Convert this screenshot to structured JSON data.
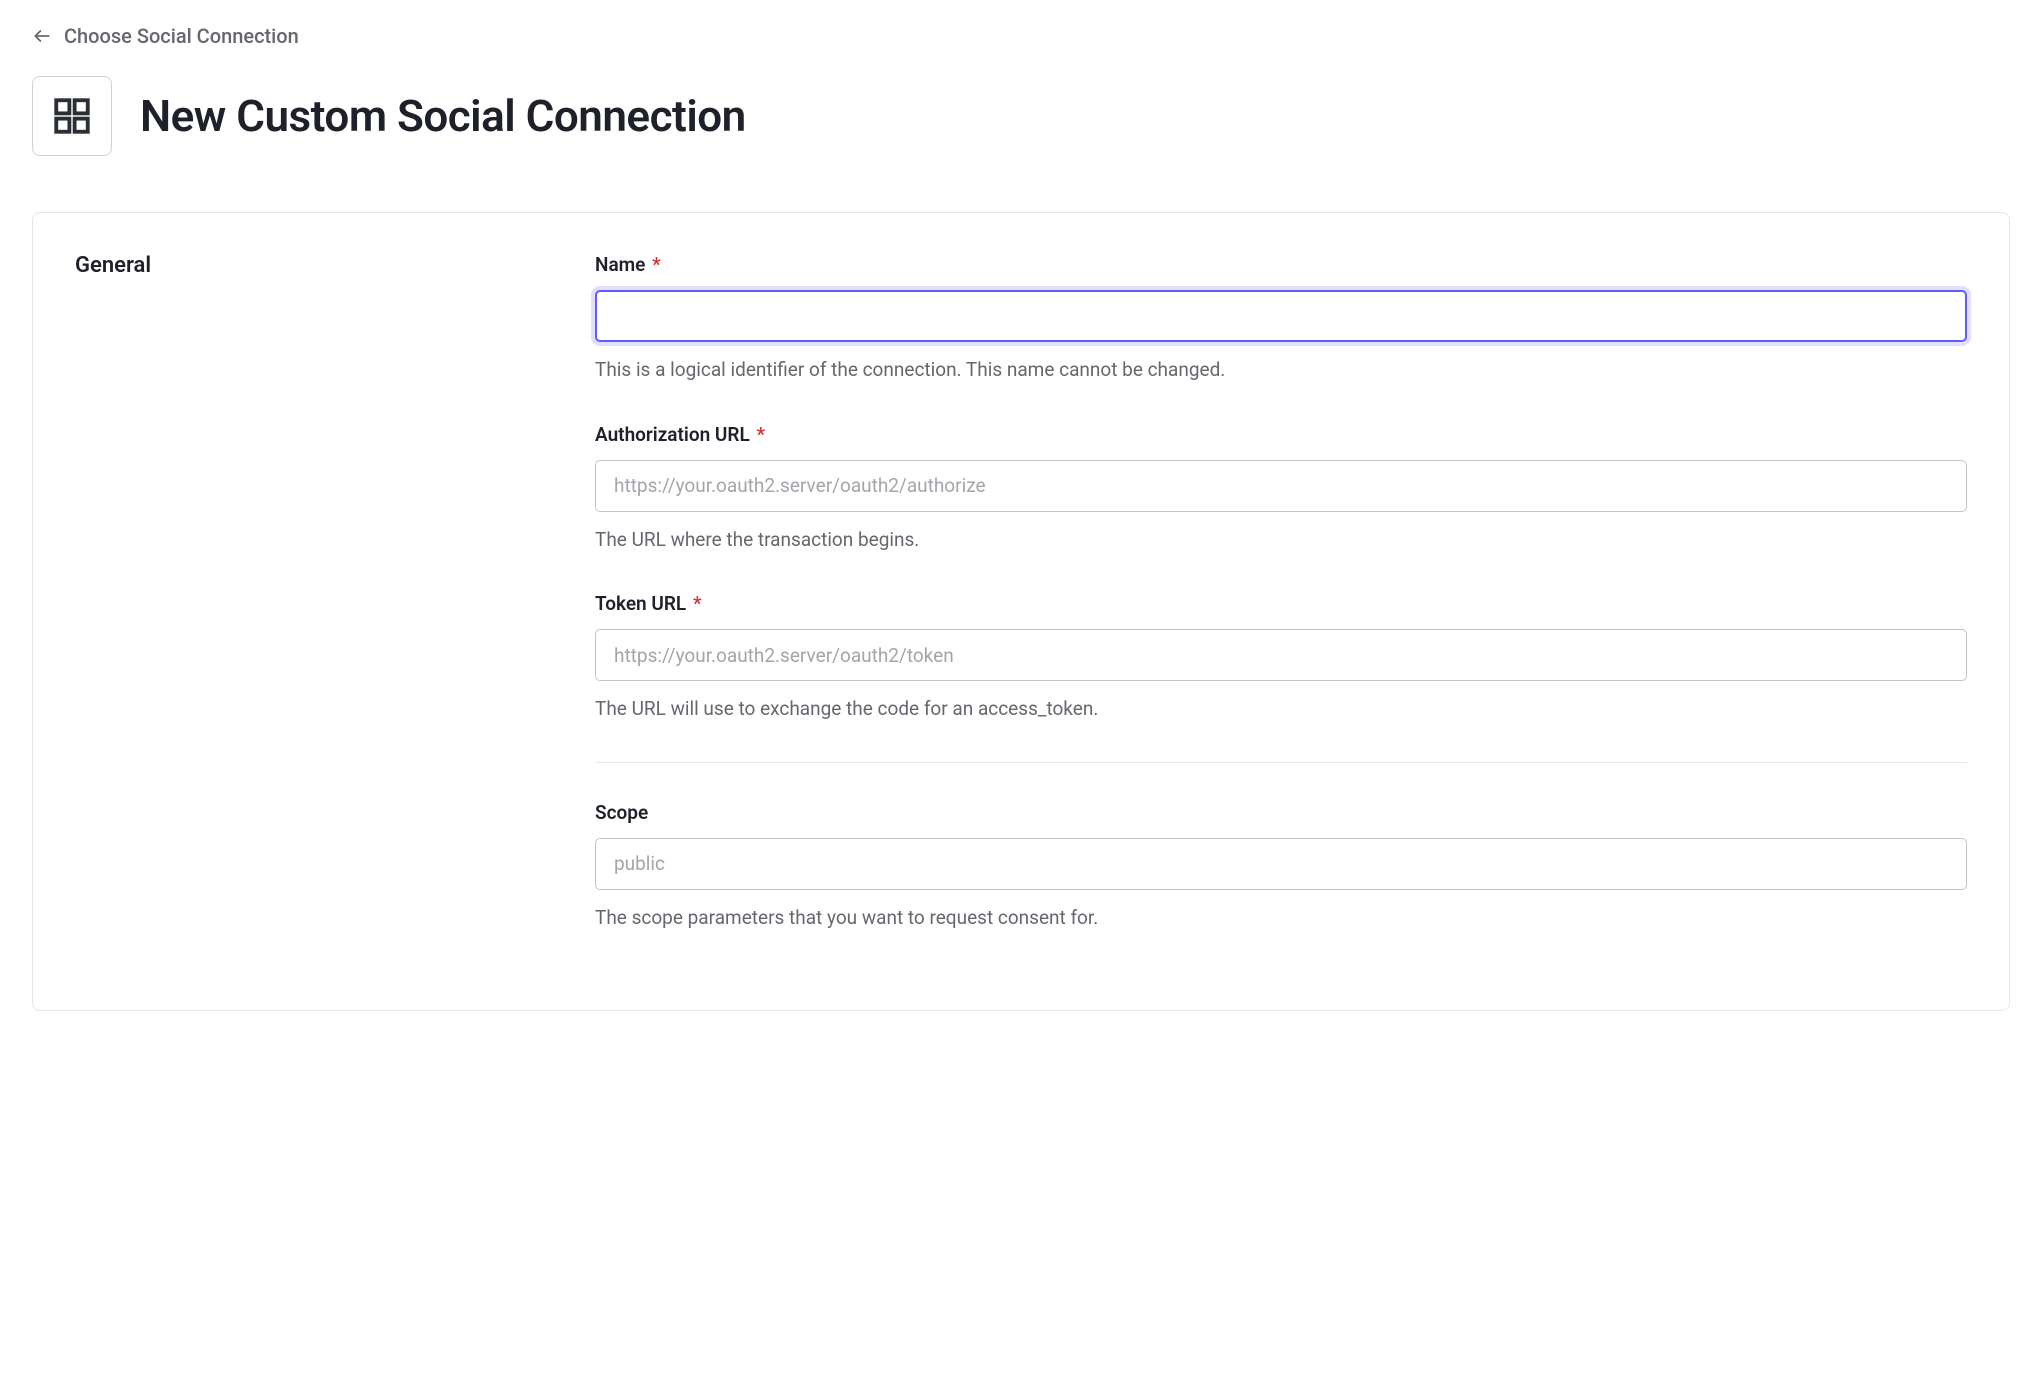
{
  "back": {
    "label": "Choose Social Connection"
  },
  "header": {
    "title": "New Custom Social Connection"
  },
  "section": {
    "label": "General"
  },
  "fields": {
    "name": {
      "label": "Name",
      "required": "*",
      "value": "",
      "hint": "This is a logical identifier of the connection. This name cannot be changed."
    },
    "authUrl": {
      "label": "Authorization URL",
      "required": "*",
      "placeholder": "https://your.oauth2.server/oauth2/authorize",
      "value": "",
      "hint": "The URL where the transaction begins."
    },
    "tokenUrl": {
      "label": "Token URL",
      "required": "*",
      "placeholder": "https://your.oauth2.server/oauth2/token",
      "value": "",
      "hint": "The URL will use to exchange the code for an access_token."
    },
    "scope": {
      "label": "Scope",
      "placeholder": "public",
      "value": "",
      "hint": "The scope parameters that you want to request consent for."
    }
  }
}
